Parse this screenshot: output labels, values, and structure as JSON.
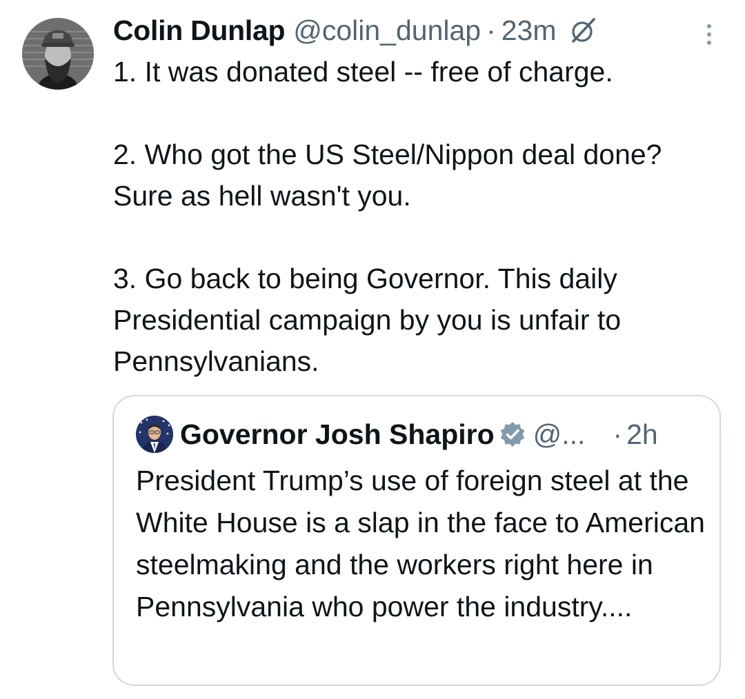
{
  "tweet": {
    "author": {
      "display_name": "Colin Dunlap",
      "handle": "@colin_dunlap",
      "avatar": "profile-photo"
    },
    "separator": "·",
    "time": "23m",
    "icons": {
      "grok": "grok-icon",
      "more": "more-options-icon"
    },
    "text": {
      "paragraph_1": "1. It was donated steel -- free of charge.",
      "paragraph_2": "2. Who got the US Steel/Nippon deal done? Sure as hell wasn't you.",
      "paragraph_3": "3. Go back to being Governor. This daily Presidential campaign by you is unfair to Pennsylvanians."
    }
  },
  "quoted_tweet": {
    "author": {
      "display_name": "Governor Josh Shapiro",
      "handle": "@...",
      "avatar": "profile-photo",
      "verified_badge": "verified-badge-icon"
    },
    "separator": "·",
    "time": "2h",
    "text": "President Trump’s use of foreign steel at the White House is a slap in the face to American steelmaking and the workers right here in Pennsylvania who power the industry...."
  },
  "colors": {
    "text_primary": "#0f1419",
    "text_secondary": "#536471",
    "border": "#cfd9de",
    "verified_badge": "#829aab"
  }
}
